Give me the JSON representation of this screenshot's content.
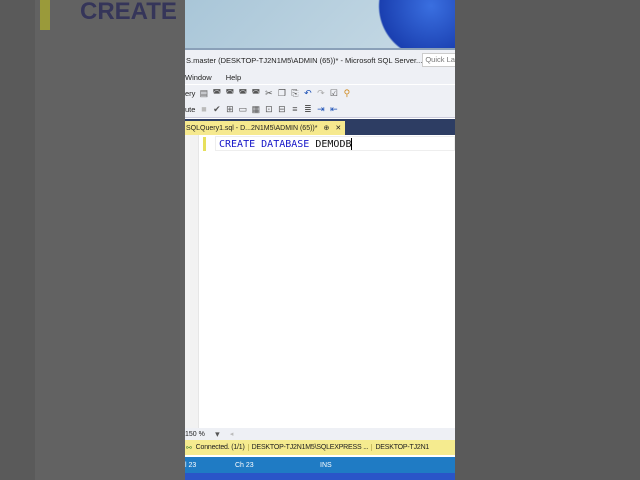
{
  "background": {
    "blurred_text": "CREATE"
  },
  "window": {
    "title": "S.master (DESKTOP-TJ2N1M5\\ADMIN (65))* - Microsoft SQL Server...",
    "quick_launch_placeholder": "Quick La",
    "menu": [
      "Window",
      "Help"
    ],
    "toolbar1_label": "ery",
    "toolbar2_label": "ute",
    "tab": {
      "label": "SQLQuery1.sql - D...2N1M5\\ADMIN (65))*",
      "pin": "⊕",
      "close": "✕"
    },
    "code": {
      "kw1": "CREATE",
      "kw2": "DATABASE",
      "name": "DEMODB"
    },
    "zoom": "150 %",
    "status": {
      "connected": "Connected. (1/1)",
      "server": "DESKTOP-TJ2N1M5\\SQLEXPRESS ...",
      "server2": "DESKTOP-TJ2N1"
    },
    "bottom": {
      "line": "l 23",
      "col": "Ch 23",
      "mode": "INS"
    }
  },
  "colors": {
    "accent": "#1f7bc4",
    "tab": "#f6e98e",
    "keyword": "#1515c8"
  }
}
